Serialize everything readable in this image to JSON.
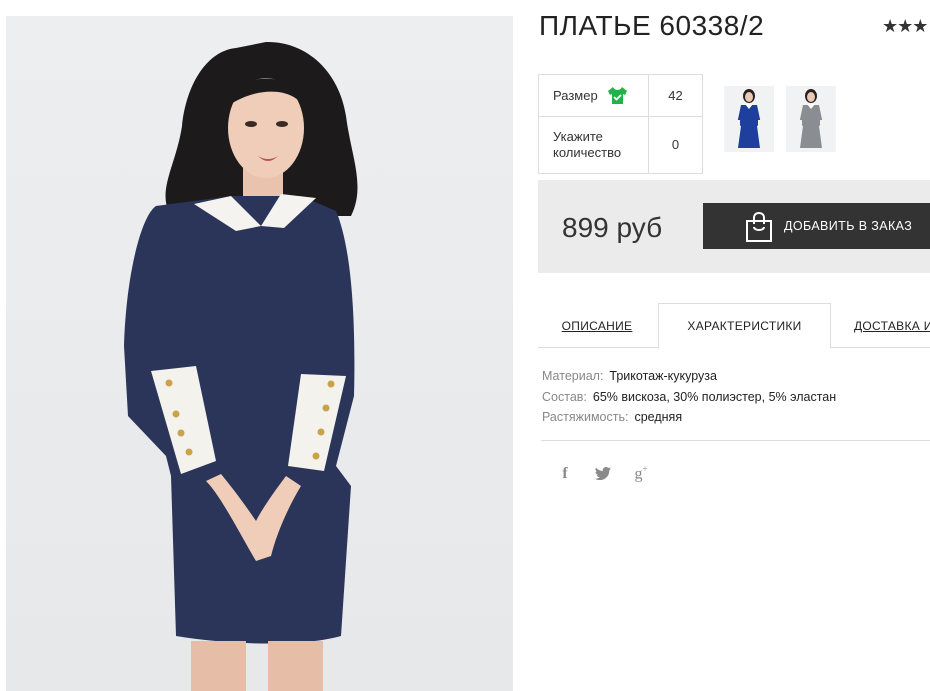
{
  "product": {
    "title": "ПЛАТЬЕ 60338/2",
    "rating_stars": "★★★",
    "price": "899 руб"
  },
  "options": {
    "size_label": "Размер",
    "size_value": "42",
    "qty_label": "Укажите количество",
    "qty_value": "0"
  },
  "actions": {
    "add_to_order": "ДОБАВИТЬ В ЗАКАЗ"
  },
  "tabs": [
    {
      "label": "ОПИСАНИЕ"
    },
    {
      "label": "ХАРАКТЕРИСТИКИ"
    },
    {
      "label": "ДОСТАВКА И"
    }
  ],
  "specs": [
    {
      "key": "Материал:",
      "value": "Трикотаж-кукуруза"
    },
    {
      "key": "Состав:",
      "value": "65% вискоза, 30% полиэстер, 5% эластан"
    },
    {
      "key": "Растяжимость:",
      "value": "средняя"
    }
  ],
  "social": {
    "facebook": "f",
    "twitter": "🐦",
    "gplus": "g"
  },
  "icons": {
    "size": "shirt-check-icon",
    "cart": "shopping-bag-icon"
  },
  "colors": {
    "dress": "#2a3559",
    "thumb_dress_blue": "#1f3f9c",
    "button_bg": "#333333",
    "price_box": "#ebebeb",
    "size_icon": "#22b24c"
  }
}
